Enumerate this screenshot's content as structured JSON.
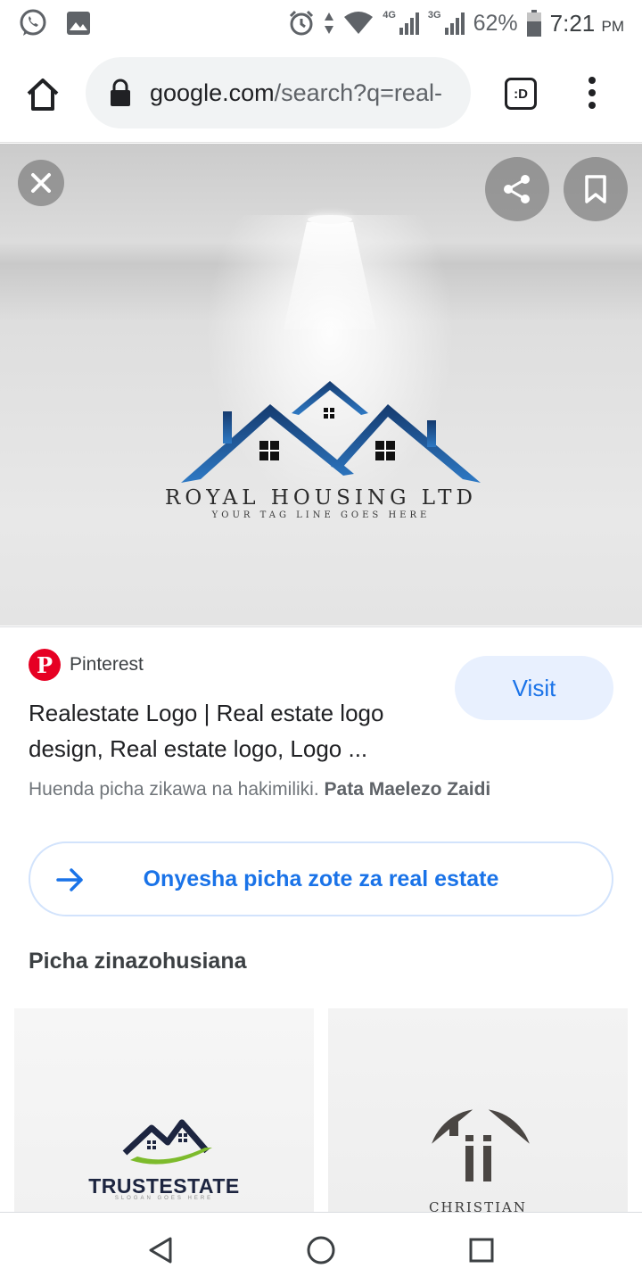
{
  "status_bar": {
    "battery": "62%",
    "time": "7:21",
    "ampm": "PM",
    "net1": "4G",
    "net2": "3G",
    "icons": [
      "whatsapp-icon",
      "gallery-icon",
      "alarm-icon",
      "data-arrows-icon",
      "wifi-icon",
      "signal-icon",
      "battery-icon"
    ]
  },
  "browser": {
    "url_host": "google.com",
    "url_path": "/search?q=real-",
    "tabs_label": ":D"
  },
  "image": {
    "logo_title": "ROYAL HOUSING LTD",
    "logo_tagline": "YOUR TAG LINE GOES HERE"
  },
  "result": {
    "source": "Pinterest",
    "title": "Realestate Logo | Real estate logo design, Real estate logo, Logo ...",
    "copyright_text": "Huenda picha zikawa na hakimiliki.",
    "learn_more": "Pata Maelezo Zaidi",
    "visit_label": "Visit",
    "show_all_label": "Onyesha picha zote za real estate"
  },
  "related": {
    "heading": "Picha zinazohusiana",
    "items": [
      {
        "name": "TRUSTESTATE",
        "slogan": "SLOGAN GOES HERE"
      },
      {
        "name": "CHRISTIAN"
      }
    ]
  },
  "colors": {
    "accent": "#1a73e8",
    "visit_bg": "#e8f0fe",
    "pinterest": "#e60023",
    "logo_blue": "#1f5fa8"
  }
}
